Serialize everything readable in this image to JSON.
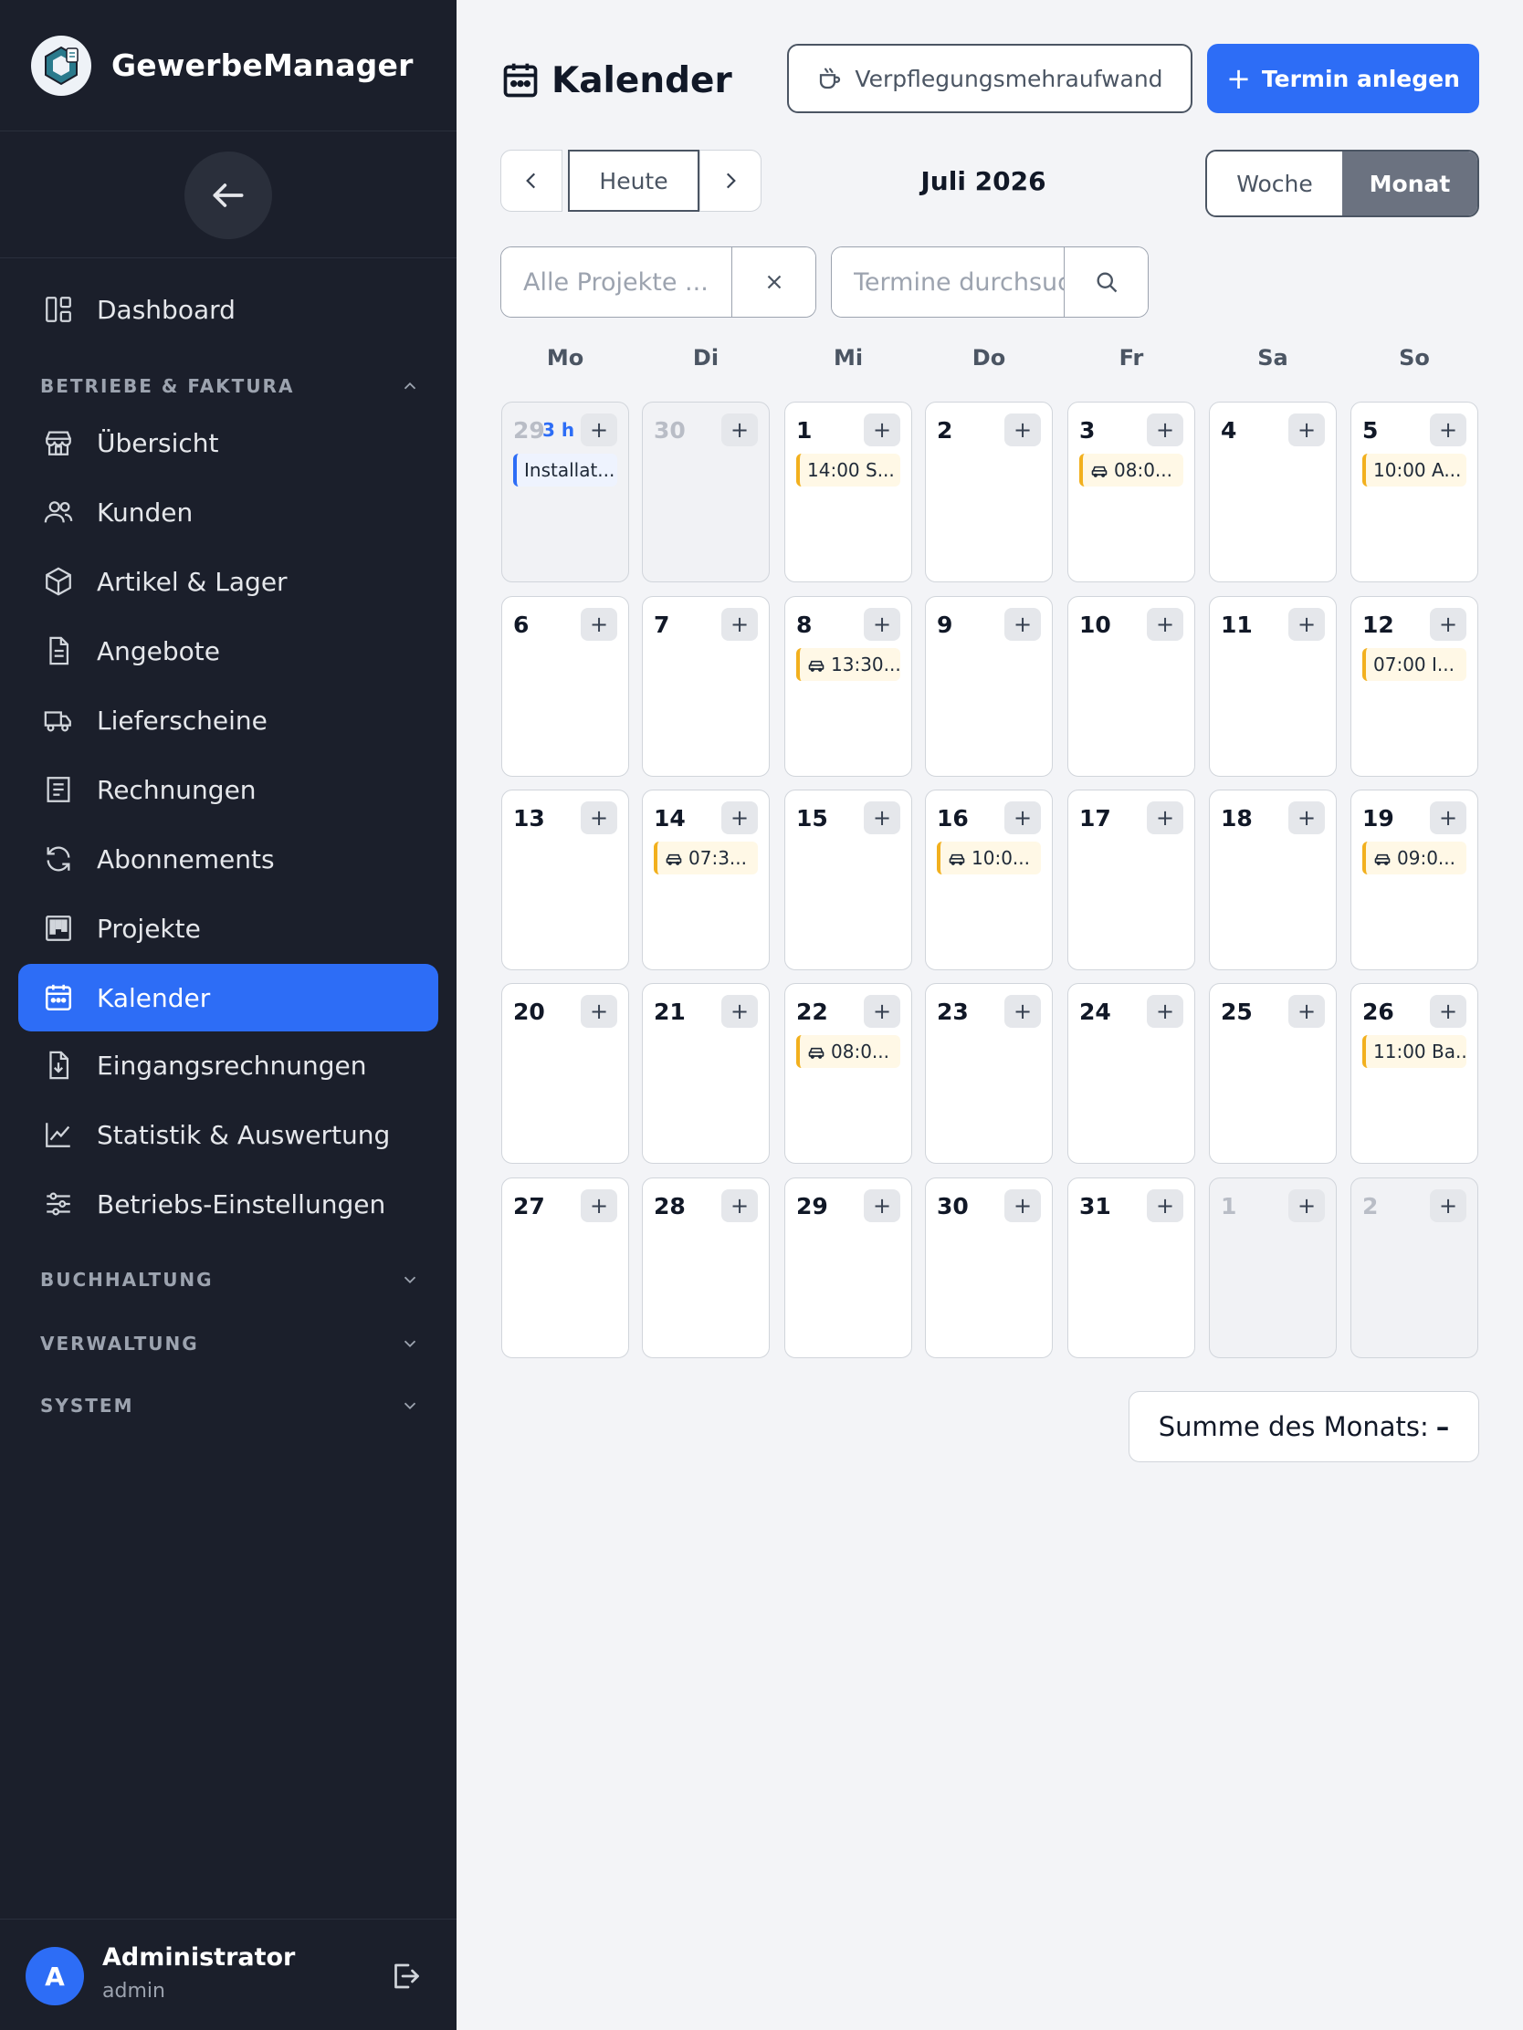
{
  "app": {
    "name": "GewerbeManager"
  },
  "sidebar": {
    "items": [
      {
        "label": "Dashboard"
      },
      {
        "label": "Übersicht"
      },
      {
        "label": "Kunden"
      },
      {
        "label": "Artikel & Lager"
      },
      {
        "label": "Angebote"
      },
      {
        "label": "Lieferscheine"
      },
      {
        "label": "Rechnungen"
      },
      {
        "label": "Abonnements"
      },
      {
        "label": "Projekte"
      },
      {
        "label": "Kalender"
      },
      {
        "label": "Eingangsrechnungen"
      },
      {
        "label": "Statistik & Auswertung"
      },
      {
        "label": "Betriebs-Einstellungen"
      }
    ],
    "sections": {
      "betriebe": "BETRIEBE & FAKTURA",
      "buchhaltung": "BUCHHALTUNG",
      "verwaltung": "VERWALTUNG",
      "system": "SYSTEM"
    },
    "active_item": "Kalender"
  },
  "user": {
    "name": "Administrator",
    "role": "admin",
    "initial": "A"
  },
  "header": {
    "title": "Kalender",
    "verpflegung_label": "Verpflegungsmehraufwand",
    "new_event_label": "Termin anlegen"
  },
  "toolbar": {
    "today_label": "Heute",
    "month_label": "Juli 2026",
    "view_week": "Woche",
    "view_month": "Monat",
    "active_view": "Monat"
  },
  "filters": {
    "project_placeholder": "Alle Projekte ...",
    "search_placeholder": "Termine durchsuchen"
  },
  "calendar": {
    "weekdays": [
      "Mo",
      "Di",
      "Mi",
      "Do",
      "Fr",
      "Sa",
      "So"
    ],
    "weeks": [
      [
        {
          "day": "29",
          "muted": true,
          "hours": "3 h",
          "events": [
            {
              "text": "Installat...",
              "color": "blue",
              "car": false
            }
          ]
        },
        {
          "day": "30",
          "muted": true,
          "events": []
        },
        {
          "day": "1",
          "events": [
            {
              "text": "14:00 S...",
              "color": "amber",
              "car": false
            }
          ]
        },
        {
          "day": "2",
          "events": []
        },
        {
          "day": "3",
          "events": [
            {
              "text": "08:0...",
              "color": "amber",
              "car": true
            }
          ]
        },
        {
          "day": "4",
          "events": []
        },
        {
          "day": "5",
          "events": [
            {
              "text": "10:00 A...",
              "color": "amber",
              "car": false
            }
          ]
        }
      ],
      [
        {
          "day": "6",
          "events": []
        },
        {
          "day": "7",
          "events": []
        },
        {
          "day": "8",
          "events": [
            {
              "text": "13:30...",
              "color": "amber",
              "car": true
            }
          ]
        },
        {
          "day": "9",
          "events": []
        },
        {
          "day": "10",
          "events": []
        },
        {
          "day": "11",
          "events": []
        },
        {
          "day": "12",
          "events": [
            {
              "text": "07:00 I...",
              "color": "amber",
              "car": false
            }
          ]
        }
      ],
      [
        {
          "day": "13",
          "events": []
        },
        {
          "day": "14",
          "events": [
            {
              "text": "07:3...",
              "color": "amber",
              "car": true
            }
          ]
        },
        {
          "day": "15",
          "events": []
        },
        {
          "day": "16",
          "events": [
            {
              "text": "10:0...",
              "color": "amber",
              "car": true
            }
          ]
        },
        {
          "day": "17",
          "events": []
        },
        {
          "day": "18",
          "events": []
        },
        {
          "day": "19",
          "events": [
            {
              "text": "09:0...",
              "color": "amber",
              "car": true
            }
          ]
        }
      ],
      [
        {
          "day": "20",
          "events": []
        },
        {
          "day": "21",
          "events": []
        },
        {
          "day": "22",
          "events": [
            {
              "text": "08:0...",
              "color": "amber",
              "car": true
            }
          ]
        },
        {
          "day": "23",
          "events": []
        },
        {
          "day": "24",
          "events": []
        },
        {
          "day": "25",
          "events": []
        },
        {
          "day": "26",
          "events": [
            {
              "text": "11:00 Ba...",
              "color": "amber",
              "car": false
            }
          ]
        }
      ],
      [
        {
          "day": "27",
          "events": []
        },
        {
          "day": "28",
          "events": []
        },
        {
          "day": "29",
          "events": []
        },
        {
          "day": "30",
          "events": []
        },
        {
          "day": "31",
          "events": []
        },
        {
          "day": "1",
          "muted": true,
          "events": []
        },
        {
          "day": "2",
          "muted": true,
          "events": []
        }
      ]
    ],
    "add_label": "+"
  },
  "summary": {
    "label": "Summe des Monats:",
    "value": "–"
  },
  "colors": {
    "accent": "#2d6df6",
    "sidebar": "#1b1f2b",
    "event_amber": "#f2b01e",
    "event_blue": "#2d6df6"
  },
  "icons": {
    "nav": [
      "dashboard-icon",
      "store-icon",
      "users-icon",
      "box-icon",
      "document-icon",
      "truck-icon",
      "receipt-icon",
      "refresh-icon",
      "kanban-icon",
      "calendar-icon",
      "file-download-icon",
      "chart-line-icon",
      "sliders-icon"
    ]
  }
}
